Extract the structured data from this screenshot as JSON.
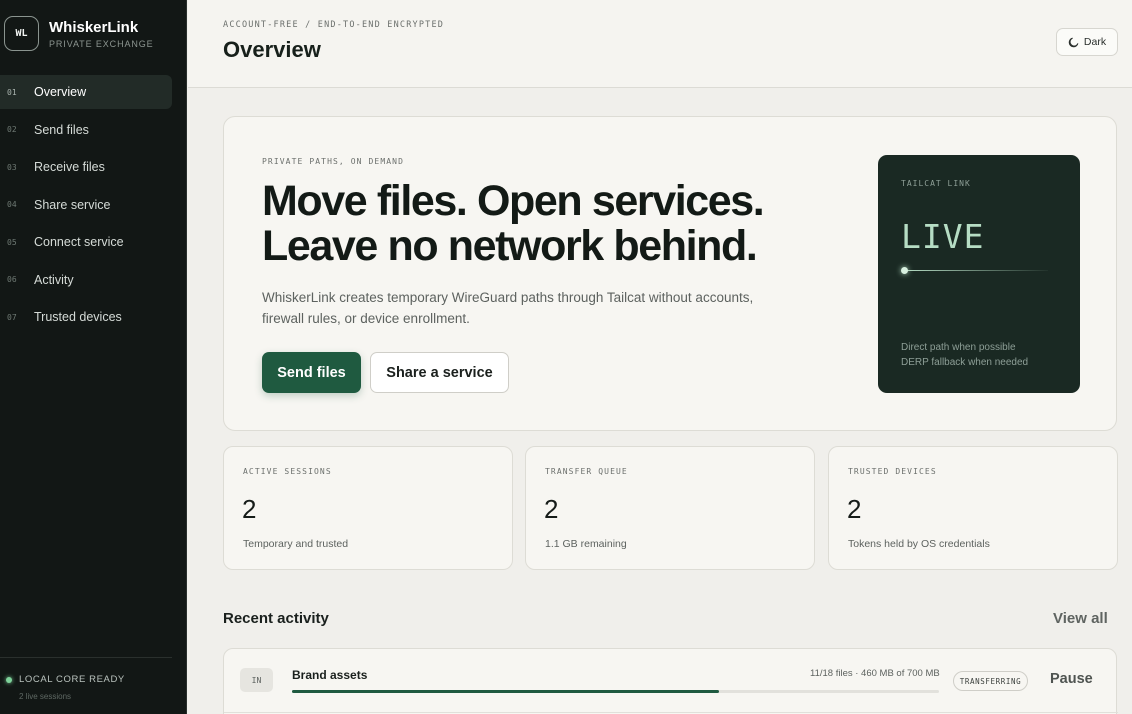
{
  "brand": {
    "mark": "WL",
    "name": "WhiskerLink",
    "subtitle": "PRIVATE EXCHANGE"
  },
  "nav": [
    {
      "num": "01",
      "label": "Overview",
      "active": true
    },
    {
      "num": "02",
      "label": "Send files"
    },
    {
      "num": "03",
      "label": "Receive files"
    },
    {
      "num": "04",
      "label": "Share service"
    },
    {
      "num": "05",
      "label": "Connect service"
    },
    {
      "num": "06",
      "label": "Activity"
    },
    {
      "num": "07",
      "label": "Trusted devices"
    }
  ],
  "sidebar_status": {
    "text": "LOCAL CORE READY",
    "sub": "2 live sessions",
    "color": "#7fd39b"
  },
  "header": {
    "eyebrow": "ACCOUNT-FREE / END-TO-END ENCRYPTED",
    "title": "Overview",
    "theme_label": "Dark",
    "theme_icon": "moon-icon"
  },
  "hero": {
    "eyebrow": "PRIVATE PATHS, ON DEMAND",
    "title_line1": "Move files. Open services.",
    "title_line2": "Leave no network behind.",
    "description": "WhiskerLink creates temporary WireGuard paths through Tailcat without accounts, firewall rules, or device enrollment.",
    "primary_label": "Send files",
    "secondary_label": "Share a service",
    "status_card": {
      "label": "TAILCAT LINK",
      "value": "LIVE",
      "note1": "Direct path when possible",
      "note2": "DERP fallback when needed"
    }
  },
  "stats": [
    {
      "label": "ACTIVE SESSIONS",
      "value": "2",
      "sub": "Temporary and trusted"
    },
    {
      "label": "TRANSFER QUEUE",
      "value": "2",
      "sub": "1.1 GB remaining"
    },
    {
      "label": "TRUSTED DEVICES",
      "value": "2",
      "sub": "Tokens held by OS credentials"
    }
  ],
  "activity": {
    "title": "Recent activity",
    "view_all": "View all",
    "items": [
      {
        "direction": "IN",
        "name": "Brand assets",
        "meta": "11/18 files · 460 MB of 700 MB",
        "progress": 0.66,
        "status": "TRANSFERRING",
        "action": "Pause"
      }
    ]
  },
  "colors": {
    "accent": "#1f5a40",
    "sidebar_bg": "#121715",
    "live": "#b6ddc4"
  }
}
